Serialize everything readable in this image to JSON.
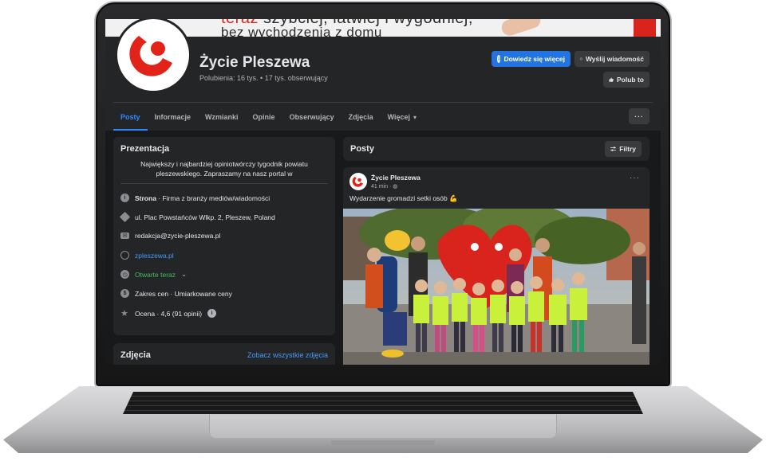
{
  "cover": {
    "line1_red": "teraz",
    "line1": "szybciej, łatwiej i wygodniej,",
    "line2": "bez wychodzenia z domu"
  },
  "page": {
    "name": "Życie Pleszewa",
    "stats": "Polubienia: 16 tys. • 17 tys. obserwujący"
  },
  "actions": {
    "learn_more": "Dowiedz się więcej",
    "message": "Wyślij wiadomość",
    "like": "Polub to",
    "more": "···"
  },
  "tabs": [
    {
      "label": "Posty",
      "active": true
    },
    {
      "label": "Informacje"
    },
    {
      "label": "Wzmianki"
    },
    {
      "label": "Opinie"
    },
    {
      "label": "Obserwujący"
    },
    {
      "label": "Zdjęcia"
    },
    {
      "label": "Więcej",
      "caret": "▾"
    }
  ],
  "intro": {
    "title": "Prezentacja",
    "description": "Największy i najbardziej opiniotwórczy tygodnik powiatu pleszewskiego. Zapraszamy na nasz portal w",
    "rows": [
      {
        "icon": "info-icon",
        "bold": "Strona",
        "text": " · Firma z branży mediów/wiadomości"
      },
      {
        "icon": "location-icon",
        "text": "ul. Plac Powstańców Wlkp. 2, Pleszew, Poland"
      },
      {
        "icon": "mail-icon",
        "text": "redakcja@zycie-pleszewa.pl"
      },
      {
        "icon": "globe-icon",
        "text": "zpleszewa.pl"
      },
      {
        "icon": "clock-icon",
        "text": "Otwarte teraz",
        "caret": "⌄"
      },
      {
        "icon": "price-icon",
        "text": "Zakres cen · Umiarkowane ceny"
      },
      {
        "icon": "star-icon",
        "text": "Ocena · 4,6 (91 opinii)"
      }
    ]
  },
  "photos": {
    "title": "Zdjęcia",
    "see_all": "Zobacz wszystkie zdjęcia"
  },
  "posts": {
    "title": "Posty",
    "filters": "Filtry"
  },
  "post": {
    "author": "Życie Pleszewa",
    "time": "41 min · ",
    "text": "Wydarzenie gromadzi setki osób 💪",
    "menu": "···"
  },
  "colors": {
    "accent": "#2374e1",
    "link": "#4599ff",
    "open": "#45bd62",
    "brand_red": "#e2231a"
  }
}
